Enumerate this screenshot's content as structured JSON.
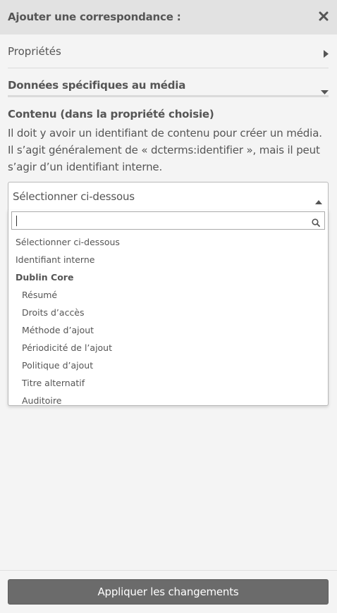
{
  "header": {
    "title": "Ajouter une correspondance :",
    "close_icon": "close-icon"
  },
  "sections": {
    "properties_label": "Propriétés",
    "media_label": "Données spécifiques au média"
  },
  "content_field": {
    "label": "Contenu (dans la propriété choisie)",
    "description": "Il doit y avoir un identifiant de contenu pour créer un média. Il s’agit généralement de « dcterms:identifier », mais il peut s’agir d’un identifiant interne."
  },
  "select": {
    "selected_value": "Sélectionner ci-dessous",
    "search_value": "",
    "options": [
      {
        "label": "Sélectionner ci-dessous",
        "kind": "top"
      },
      {
        "label": "Identifiant interne",
        "kind": "top"
      },
      {
        "label": "Dublin Core",
        "kind": "group"
      },
      {
        "label": "Résumé",
        "kind": "child"
      },
      {
        "label": "Droits d’accès",
        "kind": "child"
      },
      {
        "label": "Méthode d’ajout",
        "kind": "child"
      },
      {
        "label": "Périodicité de l’ajout",
        "kind": "child"
      },
      {
        "label": "Politique d’ajout",
        "kind": "child"
      },
      {
        "label": "Titre alternatif",
        "kind": "child"
      },
      {
        "label": "Auditoire",
        "kind": "child"
      }
    ]
  },
  "footer": {
    "apply_label": "Appliquer les changements"
  },
  "colors": {
    "header_bg": "#e2e2e2",
    "page_bg": "#f4f4f4",
    "button_bg": "#6b6b6b",
    "text": "#555555"
  }
}
